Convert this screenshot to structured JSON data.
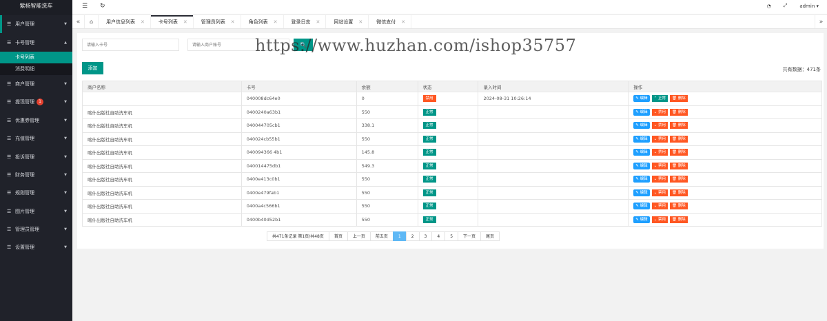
{
  "brand": "紫杨智能洗车",
  "sidebar": {
    "items": [
      {
        "label": "用户管理",
        "badge": ""
      },
      {
        "label": "卡号管理",
        "badge": ""
      },
      {
        "label": "商户管理",
        "badge": ""
      },
      {
        "label": "提现管理",
        "badge": "1"
      },
      {
        "label": "优惠券管理",
        "badge": ""
      },
      {
        "label": "充值管理",
        "badge": ""
      },
      {
        "label": "投诉管理",
        "badge": ""
      },
      {
        "label": "财务管理",
        "badge": ""
      },
      {
        "label": "规则管理",
        "badge": ""
      },
      {
        "label": "图片管理",
        "badge": ""
      },
      {
        "label": "管理员管理",
        "badge": ""
      },
      {
        "label": "设置管理",
        "badge": ""
      }
    ],
    "submenu": [
      "卡号列表",
      "消费明细"
    ]
  },
  "topbar": {
    "user": "admin ▾"
  },
  "tabs": [
    "用户信息列表",
    "卡号列表",
    "管理员列表",
    "角色列表",
    "登录日志",
    "网站设置",
    "微信支付"
  ],
  "search": {
    "card_placeholder": "请输入卡号",
    "merchant_placeholder": "请输入商户账号",
    "button_label": "🔍"
  },
  "watermark": "https://www.huzhan.com/ishop35757",
  "add_label": "添加",
  "total": "共有数据：471条",
  "table": {
    "headers": [
      "商户名称",
      "卡号",
      "余额",
      "状态",
      "录入时间",
      "操作"
    ],
    "rows": [
      {
        "merchant": "",
        "card": "040008dc64e0",
        "balance": "0",
        "status": "禁用",
        "time": "2024-08-31 10:26:14",
        "toggle": "正常"
      },
      {
        "merchant": "喀什出版社自助洗车机",
        "card": "0400240a63b1",
        "balance": "550",
        "status": "正常",
        "time": "",
        "toggle": "禁用"
      },
      {
        "merchant": "喀什出版社自助洗车机",
        "card": "040044705cb1",
        "balance": "338.1",
        "status": "正常",
        "time": "",
        "toggle": "禁用"
      },
      {
        "merchant": "喀什出版社自助洗车机",
        "card": "040024cb55b1",
        "balance": "550",
        "status": "正常",
        "time": "",
        "toggle": "禁用"
      },
      {
        "merchant": "喀什出版社自助洗车机",
        "card": "040094366 4b1",
        "balance": "145.8",
        "status": "正常",
        "time": "",
        "toggle": "禁用"
      },
      {
        "merchant": "喀什出版社自助洗车机",
        "card": "040014475db1",
        "balance": "549.3",
        "status": "正常",
        "time": "",
        "toggle": "禁用"
      },
      {
        "merchant": "喀什出版社自助洗车机",
        "card": "0400e413c0b1",
        "balance": "550",
        "status": "正常",
        "time": "",
        "toggle": "禁用"
      },
      {
        "merchant": "喀什出版社自助洗车机",
        "card": "0400e479fab1",
        "balance": "550",
        "status": "正常",
        "time": "",
        "toggle": "禁用"
      },
      {
        "merchant": "喀什出版社自助洗车机",
        "card": "0400a4c566b1",
        "balance": "550",
        "status": "正常",
        "time": "",
        "toggle": "禁用"
      },
      {
        "merchant": "喀什出版社自助洗车机",
        "card": "0400b40d52b1",
        "balance": "550",
        "status": "正常",
        "time": "",
        "toggle": "禁用"
      }
    ],
    "edit_label": "✎ 编辑",
    "delete_label": "🗑 删除"
  },
  "pager": {
    "info": "共471条记录  第1页/共48页",
    "first": "首页",
    "prev": "上一页",
    "prev5": "前五页",
    "pages": [
      "1",
      "2",
      "3",
      "4",
      "5"
    ],
    "next": "下一页",
    "last": "尾页"
  },
  "colors": {
    "accent": "#009688",
    "danger": "#ff5722",
    "info": "#1e9fff",
    "sidebar": "#20222a"
  }
}
